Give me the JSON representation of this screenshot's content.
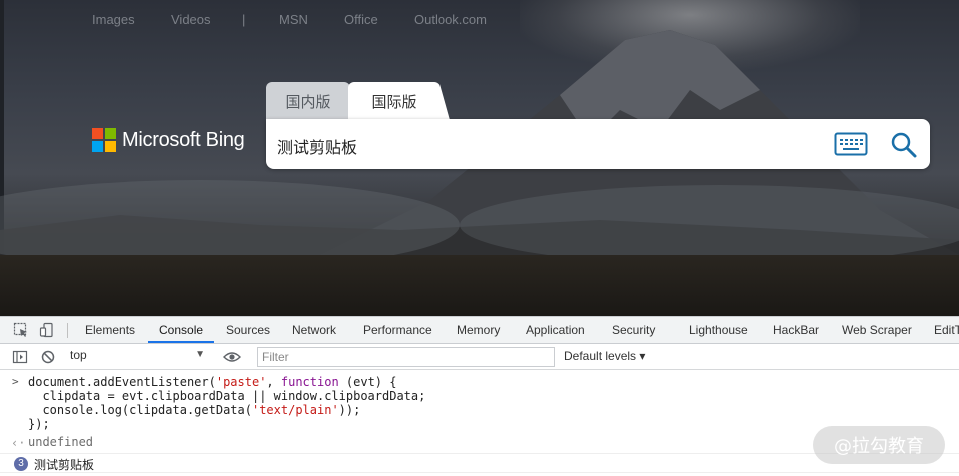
{
  "nav": {
    "images": "Images",
    "videos": "Videos",
    "separator": "|",
    "msn": "MSN",
    "office": "Office",
    "outlook": "Outlook.com"
  },
  "logo": {
    "text": "Microsoft Bing"
  },
  "tabs": {
    "domestic": "国内版",
    "international": "国际版"
  },
  "search": {
    "value": "测试剪贴板",
    "keyboard_icon": "keyboard-icon",
    "search_icon": "search-icon"
  },
  "devtools": {
    "tabs": [
      "Elements",
      "Console",
      "Sources",
      "Network",
      "Performance",
      "Memory",
      "Application",
      "Security",
      "Lighthouse",
      "HackBar",
      "Web Scraper",
      "EditThisCookie"
    ],
    "active_tab": "Console",
    "context": "top",
    "filter_placeholder": "Filter",
    "levels": "Default levels ▾"
  },
  "console": {
    "code": {
      "l1_a": "document.addEventListener(",
      "l1_str": "'paste'",
      "l1_b": ", ",
      "l1_kw": "function",
      "l1_c": " (evt) {",
      "l2": "  clipdata = evt.clipboardData || window.clipboardData;",
      "l3_a": "  console.log(clipdata.getData(",
      "l3_str": "'text/plain'",
      "l3_b": "));",
      "l4": "});"
    },
    "return_value": "undefined",
    "log_count": "3",
    "log_text": "测试剪贴板"
  },
  "watermark": "@拉勾教育",
  "colors": {
    "ms_red": "#f25022",
    "ms_green": "#7fba00",
    "ms_blue": "#00a4ef",
    "ms_yellow": "#ffb900",
    "bing_icon": "#1a6fa8",
    "devtools_active": "#1a73e8"
  }
}
